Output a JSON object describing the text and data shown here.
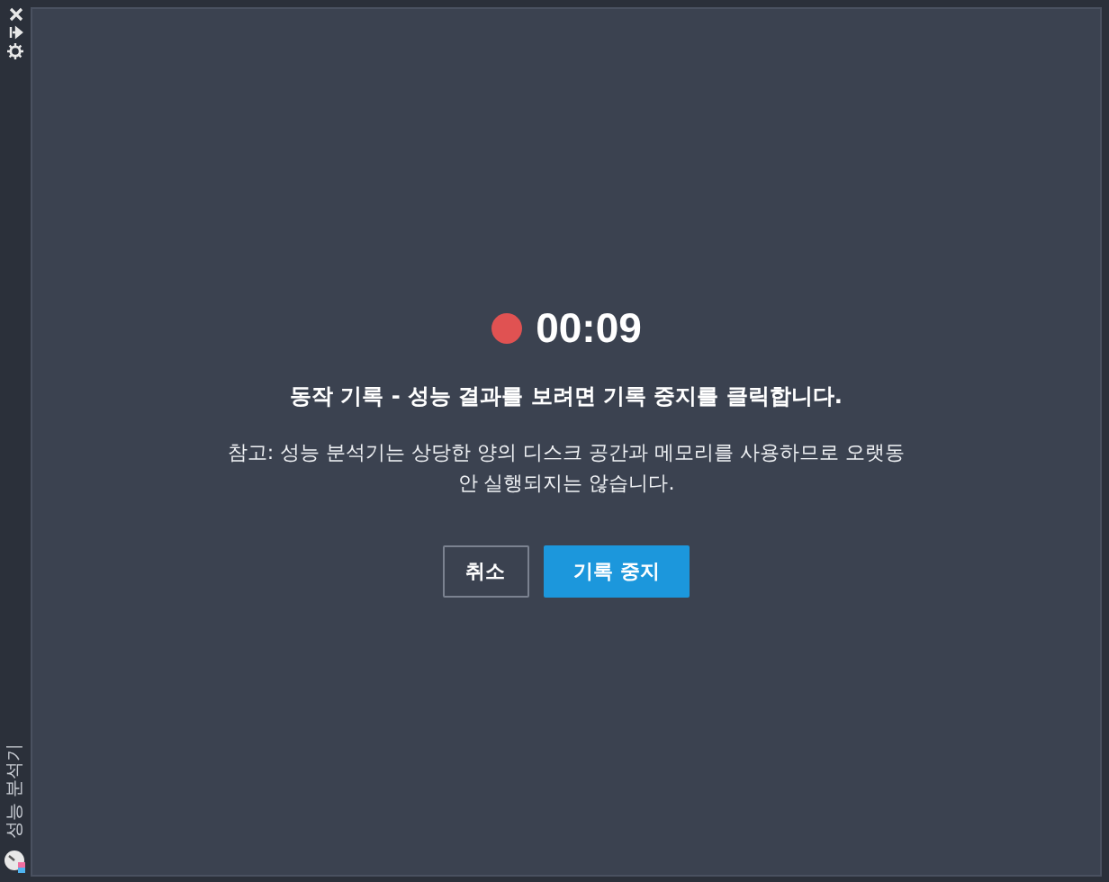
{
  "sidebar": {
    "title": "성능 분석기"
  },
  "recording": {
    "on": true,
    "time": "00:09"
  },
  "message": "동작 기록 - 성능 결과를 보려면 기록 중지를 클릭합니다.",
  "note": "참고: 성능 분석기는 상당한 양의 디스크 공간과 메모리를 사용하므로 오랫동안 실행되지는 않습니다.",
  "buttons": [
    {
      "label": "취소",
      "kind": "secondary"
    },
    {
      "label": "기록 중지",
      "kind": "primary"
    }
  ]
}
